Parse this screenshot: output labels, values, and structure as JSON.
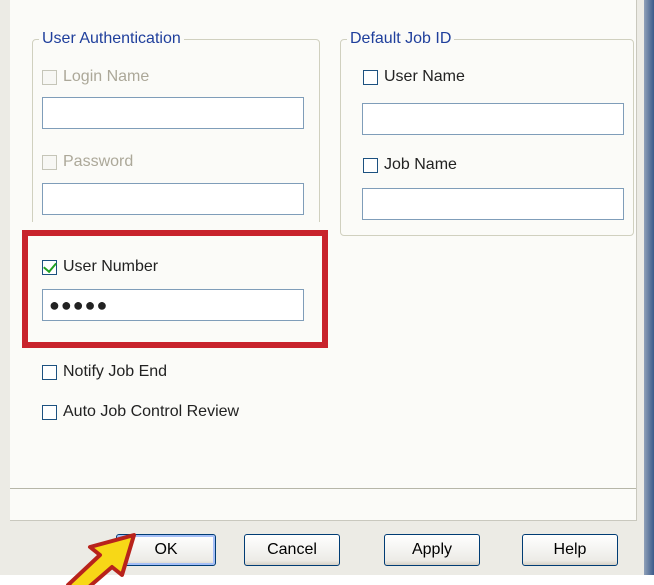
{
  "user_authentication": {
    "legend": "User Authentication",
    "login_name_label": "Login Name",
    "login_name_value": "",
    "password_label": "Password",
    "password_value": "",
    "user_number_label": "User Number",
    "user_number_checked": true,
    "user_number_value": "●●●●●"
  },
  "default_job_id": {
    "legend": "Default Job ID",
    "user_name_label": "User Name",
    "user_name_value": "",
    "job_name_label": "Job Name",
    "job_name_value": ""
  },
  "options": {
    "notify_job_end_label": "Notify Job End",
    "auto_job_control_review_label": "Auto Job Control Review"
  },
  "buttons": {
    "ok": "OK",
    "cancel": "Cancel",
    "apply": "Apply",
    "help": "Help"
  },
  "colors": {
    "highlight": "#c8232c",
    "arrow_fill": "#f7d817",
    "group_legend": "#1f3f9c"
  }
}
